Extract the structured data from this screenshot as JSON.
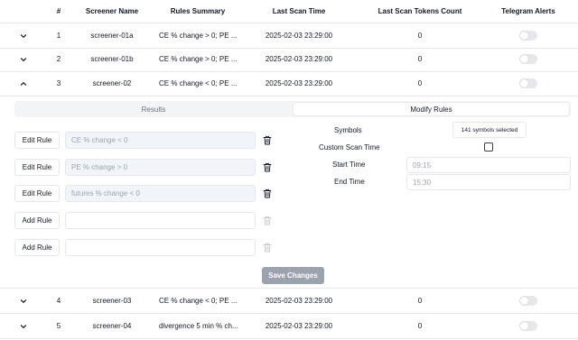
{
  "columns": {
    "num": "#",
    "name": "Screener Name",
    "rules": "Rules Summary",
    "scan_time": "Last Scan Time",
    "tokens": "Last Scan Tokens Count",
    "telegram": "Telegram Alerts"
  },
  "rows": [
    {
      "num": "1",
      "name": "screener-01a",
      "rules": "CE % change > 0; PE ...",
      "scan_time": "2025-02-03 23:29:00",
      "tokens": "0",
      "telegram_enabled": false,
      "expanded": false
    },
    {
      "num": "2",
      "name": "screener-01b",
      "rules": "CE % change > 0; PE ...",
      "scan_time": "2025-02-03 23:29:00",
      "tokens": "0",
      "telegram_enabled": false,
      "expanded": false
    },
    {
      "num": "3",
      "name": "screener-02",
      "rules": "CE % change < 0; PE ...",
      "scan_time": "2025-02-03 23:29:00",
      "tokens": "0",
      "telegram_enabled": false,
      "expanded": true
    },
    {
      "num": "4",
      "name": "screener-03",
      "rules": "CE % change < 0; PE ...",
      "scan_time": "2025-02-03 23:29:00",
      "tokens": "0",
      "telegram_enabled": false,
      "expanded": false
    },
    {
      "num": "5",
      "name": "screener-04",
      "rules": "divergence 5 min % ch...",
      "scan_time": "2025-02-03 23:29:00",
      "tokens": "0",
      "telegram_enabled": false,
      "expanded": false
    }
  ],
  "detail": {
    "tabs": {
      "results": "Results",
      "modify": "Modify Rules",
      "active": "modify"
    },
    "rules": [
      {
        "button": "Edit Rule",
        "value": "CE % change < 0"
      },
      {
        "button": "Edit Rule",
        "value": "PE % change > 0"
      },
      {
        "button": "Edit Rule",
        "value": "futures % change < 0"
      },
      {
        "button": "Add Rule",
        "value": ""
      },
      {
        "button": "Add Rule",
        "value": ""
      }
    ],
    "symbols_label": "Symbols",
    "symbols_value": "141 symbols selected",
    "custom_scan_label": "Custom Scan Time",
    "custom_scan_checked": false,
    "start_label": "Start Time",
    "start_placeholder": "09:15",
    "end_label": "End Time",
    "end_placeholder": "15:30",
    "save_label": "Save Changes"
  },
  "colors": {
    "save_disabled": "#9ca3af",
    "filled_input": "#f1f5f9",
    "toggle_off": "#e5e7eb"
  }
}
